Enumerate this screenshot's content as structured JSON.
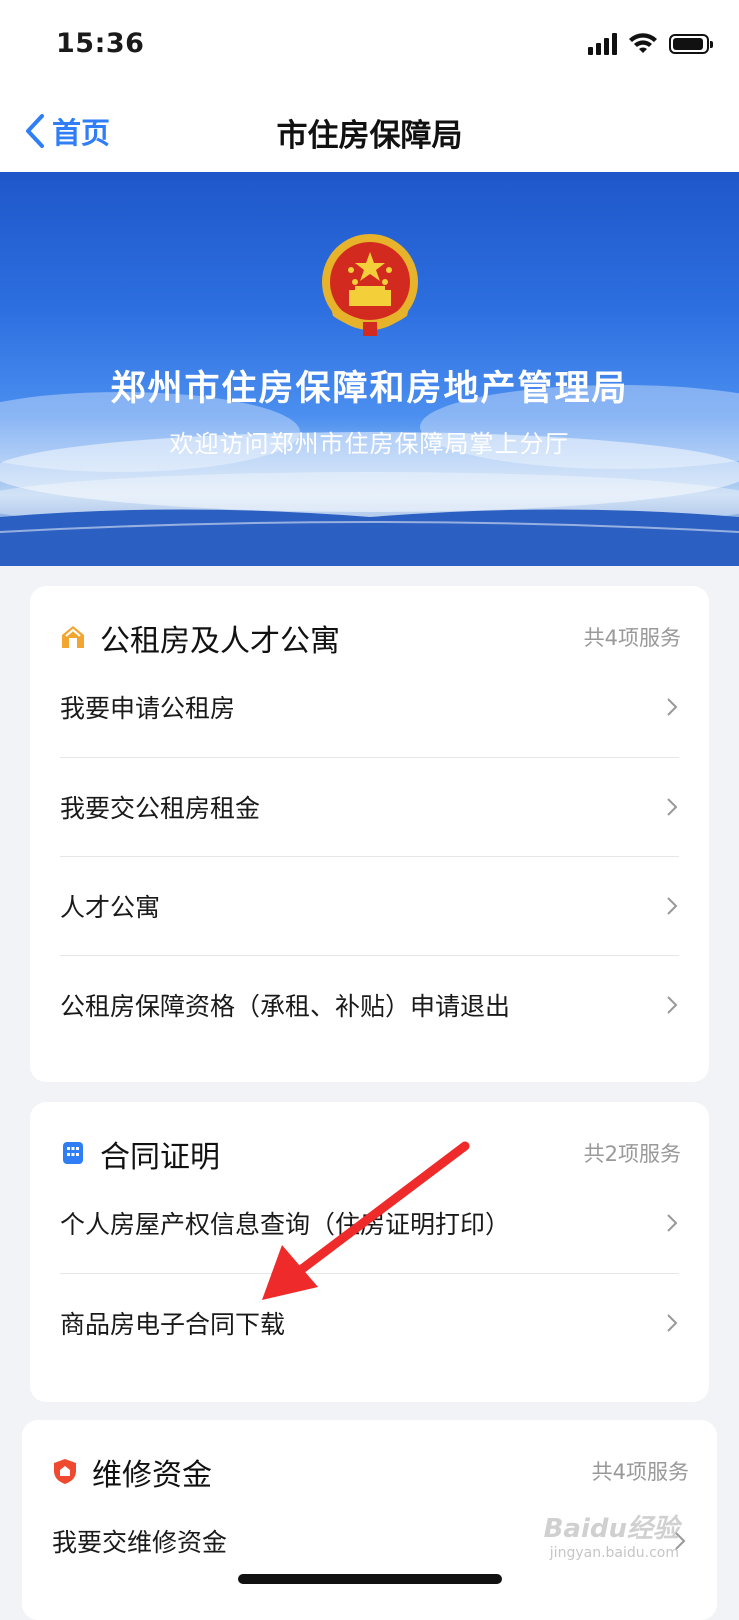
{
  "status_bar": {
    "time": "15:36"
  },
  "nav": {
    "back_label": "首页",
    "title": "市住房保障局"
  },
  "banner": {
    "title": "郑州市住房保障和房地产管理局",
    "subtitle": "欢迎访问郑州市住房保障局掌上分厅"
  },
  "sections": [
    {
      "title": "公租房及人才公寓",
      "count": "共4项服务",
      "icon": "house-icon",
      "items": [
        {
          "label": "我要申请公租房"
        },
        {
          "label": "我要交公租房租金"
        },
        {
          "label": "人才公寓"
        },
        {
          "label": "公租房保障资格（承租、补贴）申请退出"
        }
      ]
    },
    {
      "title": "合同证明",
      "count": "共2项服务",
      "icon": "building-icon",
      "items": [
        {
          "label": "个人房屋产权信息查询（住房证明打印）"
        },
        {
          "label": "商品房电子合同下载"
        }
      ]
    },
    {
      "title": "维修资金",
      "count": "共4项服务",
      "icon": "shield-icon",
      "items": [
        {
          "label": "我要交维修资金"
        }
      ]
    }
  ],
  "watermark": {
    "text": "Baidu经验",
    "sub": "jingyan.baidu.com"
  },
  "colors": {
    "accent": "#2f7ef5",
    "annotation_arrow": "#ee2a2a"
  }
}
